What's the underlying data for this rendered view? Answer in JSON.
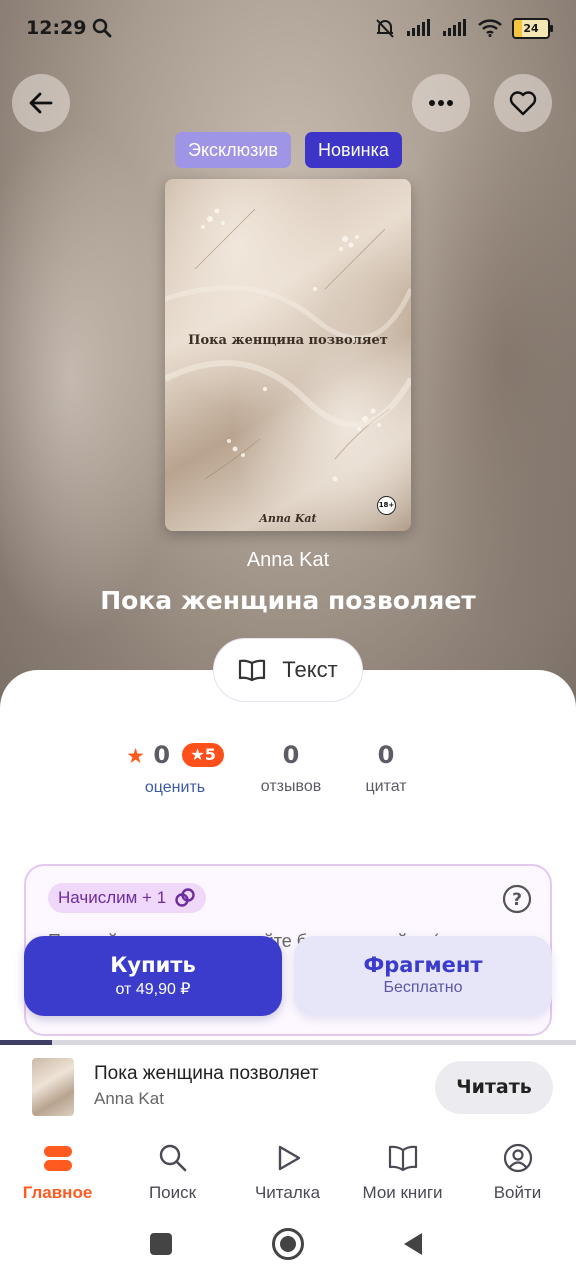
{
  "status_bar": {
    "time": "12:29",
    "battery": "24"
  },
  "tags": {
    "exclusive": "Эксклюзив",
    "new": "Новинка"
  },
  "cover": {
    "title": "Пока женщина позволяет",
    "author": "Anna Kat",
    "age": "18+"
  },
  "book": {
    "author": "Anna Kat",
    "title": "Пока женщина позволяет",
    "format": "Текст"
  },
  "stats": {
    "rating": "0",
    "rating_badge": "5",
    "rating_caption": "оценить",
    "reviews": "0",
    "reviews_caption": "отзывов",
    "quotes": "0",
    "quotes_caption": "цитат"
  },
  "promo": {
    "chip": "Начислим + 1",
    "text": "Покупайте книги и получайте бонусы в ... й ... (частично скрыто кнопками)"
  },
  "actions": {
    "buy_label": "Купить",
    "buy_price": "от 49,90 ₽",
    "fragment_label": "Фрагмент",
    "fragment_sub": "Бесплатно"
  },
  "progress": 0.09,
  "mini_player": {
    "title": "Пока женщина позволяет",
    "author": "Anna Kat",
    "read_label": "Читать"
  },
  "tabs": [
    {
      "label": "Главное",
      "icon": "home-icon"
    },
    {
      "label": "Поиск",
      "icon": "search-icon"
    },
    {
      "label": "Читалка",
      "icon": "play-icon"
    },
    {
      "label": "Мои книги",
      "icon": "book-icon"
    },
    {
      "label": "Войти",
      "icon": "account-icon"
    }
  ],
  "colors": {
    "accent": "#3c3ccc",
    "orange": "#ff5a1f",
    "promo_border": "#e4c8f0"
  }
}
